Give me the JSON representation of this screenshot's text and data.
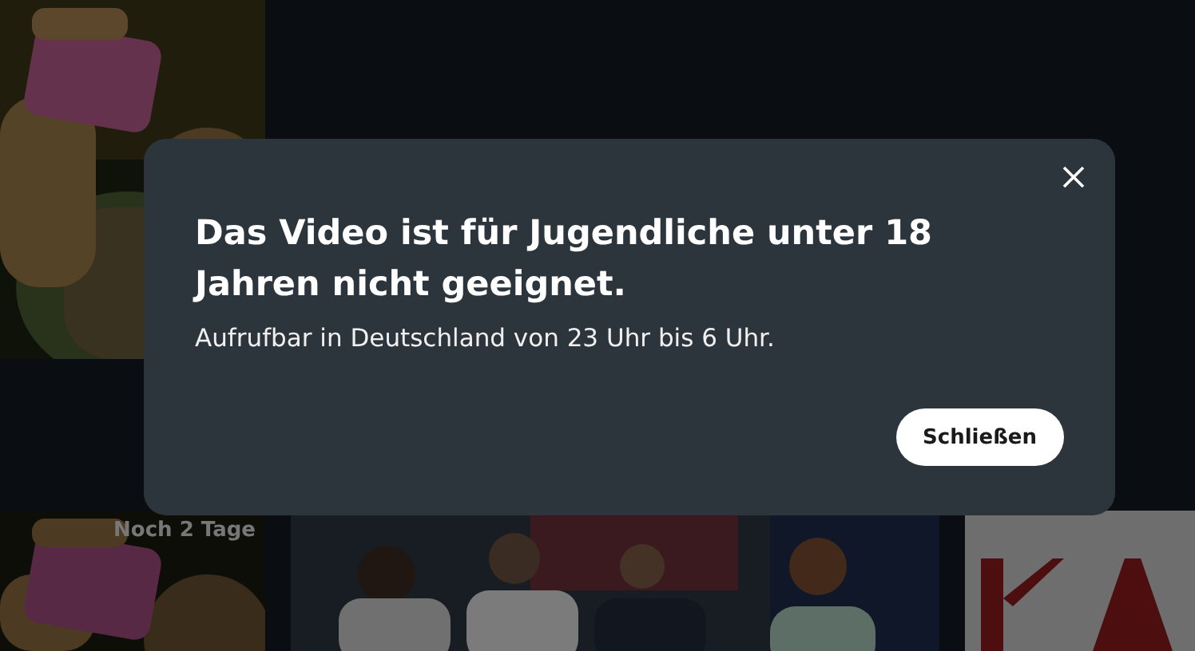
{
  "row_2": {
    "badge": "Noch 2 Tage"
  },
  "dialog": {
    "title": "Das Video ist für Jugendliche unter 18 Jahren nicht geeignet.",
    "message": "Aufrufbar in Deutschland von 23 Uhr bis 6 Uhr.",
    "button": "Schließen"
  }
}
